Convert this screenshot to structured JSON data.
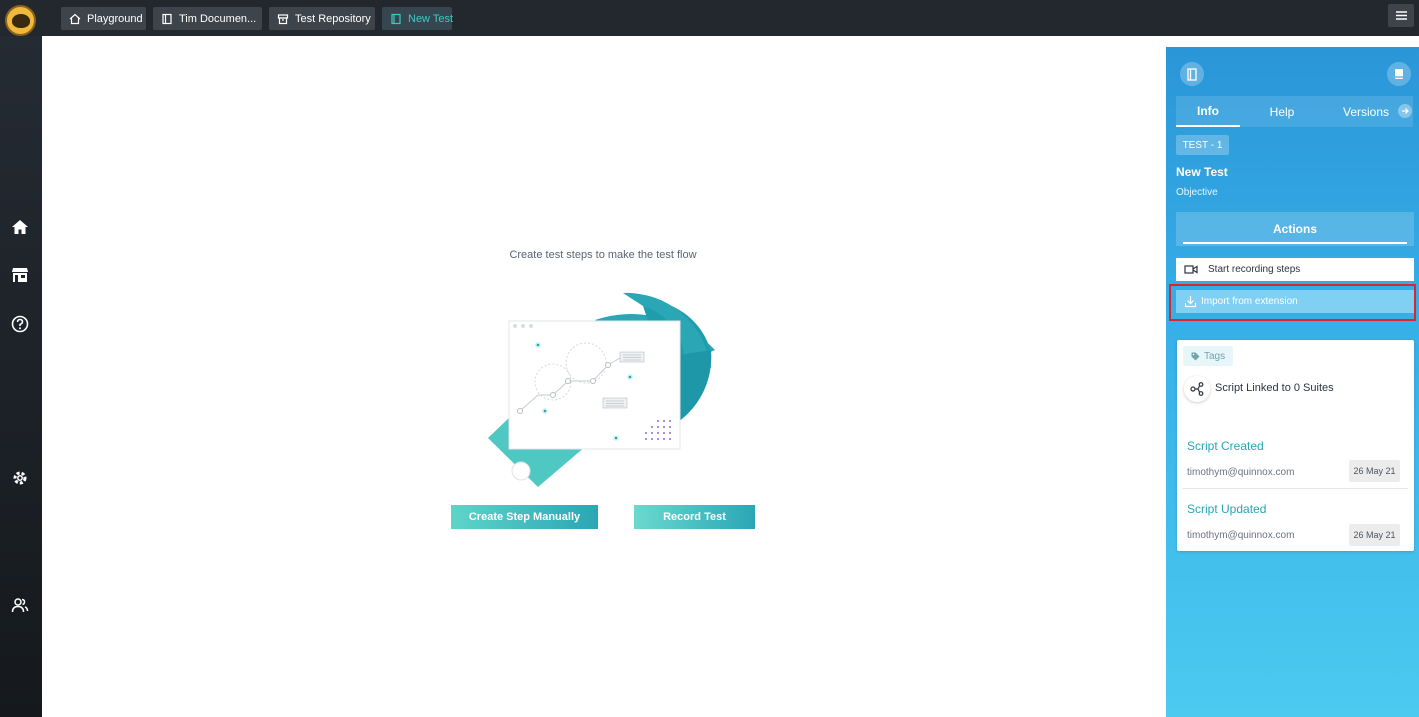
{
  "topbar": {
    "tabs": [
      {
        "label": "Playground",
        "icon": "home-icon"
      },
      {
        "label": "Tim Documen...",
        "icon": "documents-icon"
      },
      {
        "label": "Test Repository",
        "icon": "repository-icon"
      },
      {
        "label": "New Test",
        "icon": "document-icon",
        "active": true
      }
    ]
  },
  "sidebar": {
    "items": [
      {
        "icon": "home-icon"
      },
      {
        "icon": "store-icon"
      },
      {
        "icon": "help-icon"
      },
      {
        "icon": "settings-icon"
      },
      {
        "icon": "users-icon"
      }
    ]
  },
  "main": {
    "prompt": "Create test steps to make the test flow",
    "create_button": "Create Step Manually",
    "record_button": "Record Test"
  },
  "panel": {
    "tabs": [
      "Info",
      "Help",
      "Versions"
    ],
    "active_tab": "Info",
    "test_id": "TEST - 1",
    "test_name": "New Test",
    "objective": "Objective",
    "actions_title": "Actions",
    "actions": [
      {
        "label": "Start recording steps",
        "icon": "video-camera-icon"
      },
      {
        "label": "Import from extension",
        "icon": "import-icon"
      }
    ],
    "card": {
      "tag_label": "Tags",
      "linked_text": "Script Linked to 0 Suites",
      "created_title": "Script Created",
      "created_email": "timothym@quinnox.com",
      "created_date": "26 May 21",
      "updated_title": "Script Updated",
      "updated_email": "timothym@quinnox.com",
      "updated_date": "26 May 21"
    }
  },
  "colors": {
    "topbar": "#23282f",
    "accent_teal": "#2aa6b5",
    "panel_blue": "#2a96d8",
    "highlight_red": "#d7282f"
  }
}
